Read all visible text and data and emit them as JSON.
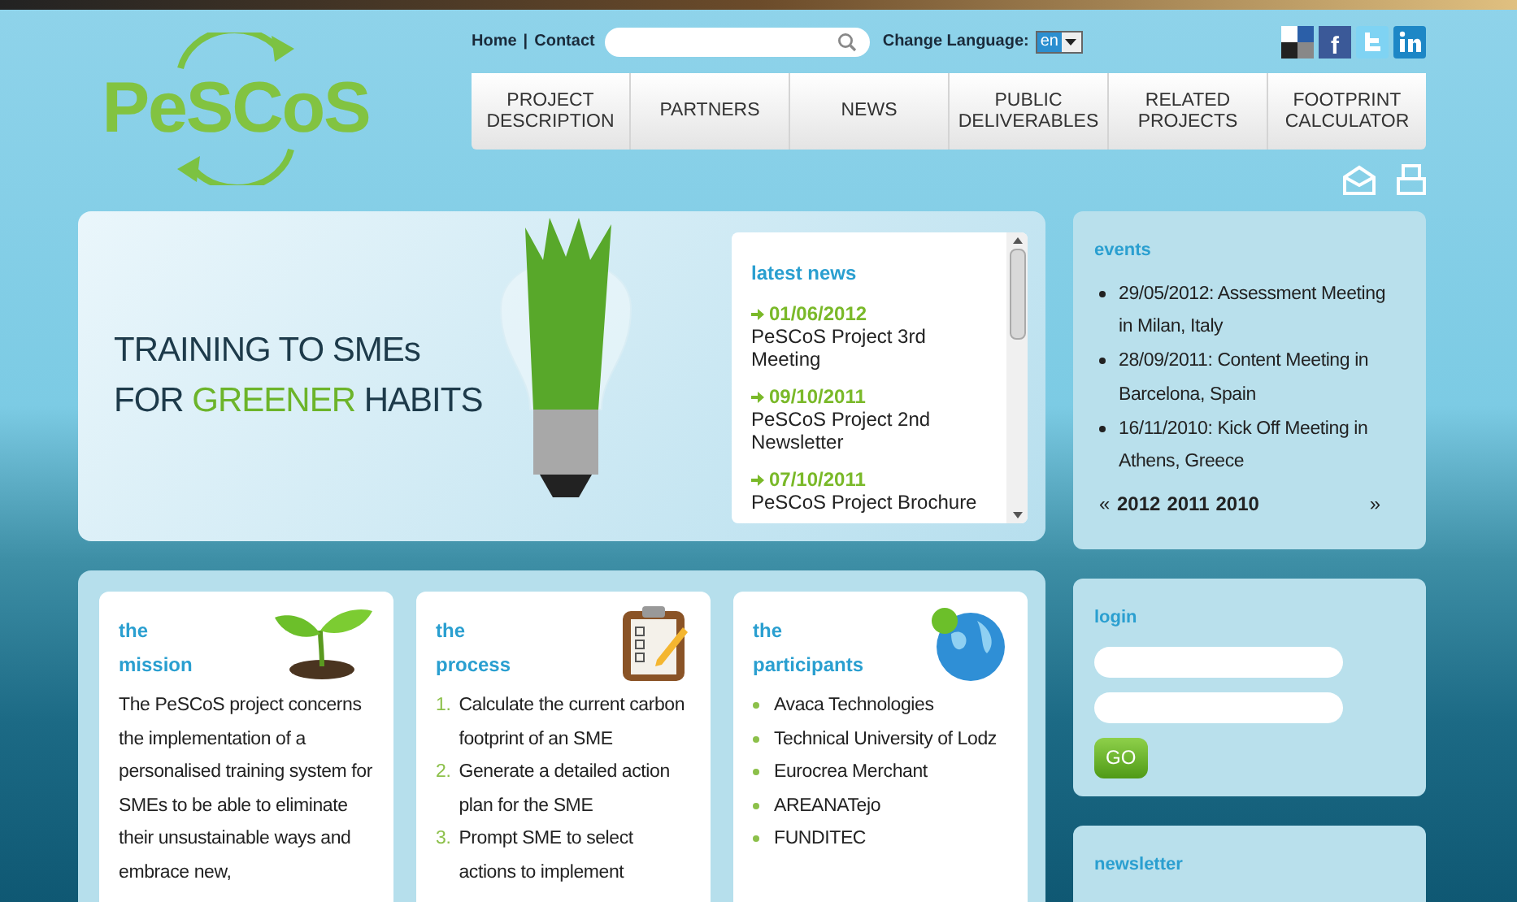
{
  "logo": {
    "text": "PeSCoS"
  },
  "top_links": {
    "items": [
      "Home",
      "Contact"
    ],
    "separator": "|"
  },
  "social": {
    "facebook": "f"
  },
  "language": {
    "label": "Change Language:",
    "value": "en"
  },
  "nav": [
    {
      "label": "PROJECT DESCRIPTION"
    },
    {
      "label": "PARTNERS"
    },
    {
      "label": "NEWS"
    },
    {
      "label": "PUBLIC DELIVERABLES"
    },
    {
      "label": "RELATED PROJECTS"
    },
    {
      "label": "FOOTPRINT CALCULATOR"
    }
  ],
  "banner": {
    "line1": "TRAINING TO SMEs",
    "line2": [
      {
        "text": "FOR",
        "highlight": false
      },
      {
        "text": "GREENER",
        "highlight": true
      },
      {
        "text": "HABITS",
        "highlight": false
      }
    ]
  },
  "latest_news": {
    "title": "latest news",
    "items": [
      {
        "date": "01/06/2012",
        "title": "PeSCoS Project 3rd Meeting"
      },
      {
        "date": "09/10/2011",
        "title": "PeSCoS Project 2nd Newsletter"
      },
      {
        "date": "07/10/2011",
        "title": "PeSCoS Project Brochure"
      }
    ]
  },
  "events": {
    "title": "events",
    "items": [
      "29/05/2012: Assessment Meeting in Milan, Italy",
      "28/09/2011: Content Meeting in Barcelona, Spain",
      "16/11/2010: Kick Off Meeting in Athens, Greece"
    ],
    "prev": "«",
    "years": [
      "2012",
      "2011",
      "2010"
    ],
    "next": "»"
  },
  "cards": [
    {
      "kind": "text",
      "title_1": "the",
      "title_2": "mission",
      "body": "The PeSCoS project concerns the implementation of a personalised training system for SMEs to be able to eliminate their unsustainable ways and embrace new,"
    },
    {
      "kind": "ordered",
      "title_1": "the",
      "title_2": "process",
      "items": [
        {
          "number": "1.",
          "text": "Calculate the current carbon footprint of an SME"
        },
        {
          "number": "2.",
          "text": "Generate a detailed action plan for the SME"
        },
        {
          "number": "3.",
          "text": "Prompt SME to select actions to implement"
        }
      ]
    },
    {
      "kind": "bullets",
      "title_1": "the",
      "title_2": "participants",
      "items": [
        {
          "text": "Avaca Technologies"
        },
        {
          "text": "Technical University of Lodz"
        },
        {
          "text": "Eurocrea Merchant"
        },
        {
          "text": "AREANATejo"
        },
        {
          "text": "FUNDITEC"
        }
      ]
    }
  ],
  "login": {
    "title": "login",
    "button": "GO"
  },
  "newsletter": {
    "title": "newsletter"
  }
}
